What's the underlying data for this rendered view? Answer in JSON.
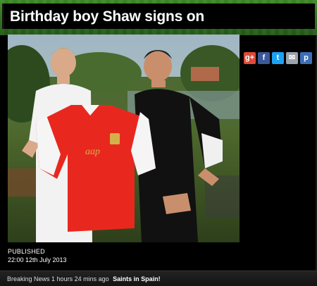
{
  "article": {
    "title": "Birthday boy Shaw signs on",
    "published_label": "PUBLISHED",
    "published_time": "22:00 12th July 2013"
  },
  "share": [
    {
      "icon": "google-plus-icon",
      "glyph": "g+",
      "color": "#dd4b39"
    },
    {
      "icon": "facebook-icon",
      "glyph": "f",
      "color": "#3b5998"
    },
    {
      "icon": "twitter-icon",
      "glyph": "t",
      "color": "#1da1f2"
    },
    {
      "icon": "email-icon",
      "glyph": "✉",
      "color": "#9aa3ad"
    },
    {
      "icon": "pinterest-icon",
      "glyph": "p",
      "color": "#3b6fb6"
    }
  ],
  "news_ticker": {
    "label": "Breaking News",
    "age": "1 hours 24 mins ago",
    "headline": "Saints in Spain!"
  },
  "colors": {
    "header_green": "#2f6f1f",
    "shirt_red": "#e8281e"
  }
}
